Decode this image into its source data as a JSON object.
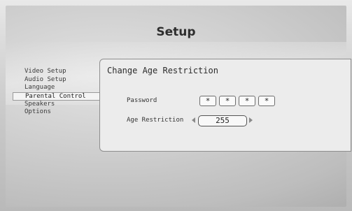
{
  "window": {
    "title": "Setup"
  },
  "menu": {
    "items": [
      {
        "label": "Video Setup"
      },
      {
        "label": "Audio Setup"
      },
      {
        "label": "Language"
      },
      {
        "label": "Parental Control",
        "selected": true
      },
      {
        "label": "Speakers"
      },
      {
        "label": "Options"
      }
    ]
  },
  "panel": {
    "title": "Change Age Restriction",
    "password": {
      "label": "Password",
      "chars": [
        "*",
        "*",
        "*",
        "*"
      ]
    },
    "age": {
      "label": "Age Restriction",
      "value": "255"
    }
  },
  "icons": {
    "prev": "left-arrow-icon",
    "next": "right-arrow-icon"
  }
}
